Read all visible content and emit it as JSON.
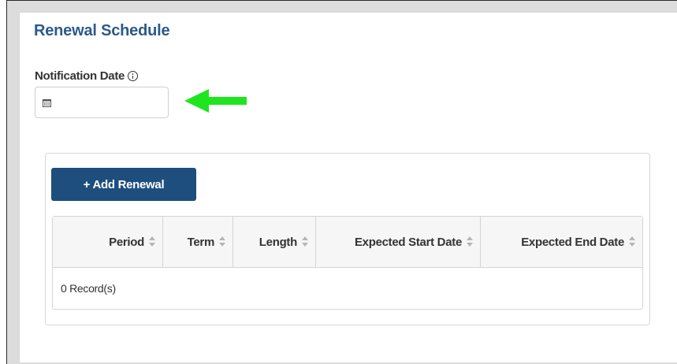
{
  "section": {
    "title": "Renewal Schedule"
  },
  "notification": {
    "label": "Notification Date",
    "value": ""
  },
  "toolbar": {
    "add_label": "+ Add Renewal"
  },
  "table": {
    "columns": [
      "Period",
      "Term",
      "Length",
      "Expected Start Date",
      "Expected End Date"
    ],
    "rows": [],
    "footer_text": "0 Record(s)"
  },
  "colors": {
    "accent": "#2c5a8a",
    "button": "#1d4e7e",
    "arrow": "#1fe51f"
  },
  "icons": [
    "info-icon",
    "calendar-icon",
    "sort-icon",
    "arrow-left-icon"
  ]
}
